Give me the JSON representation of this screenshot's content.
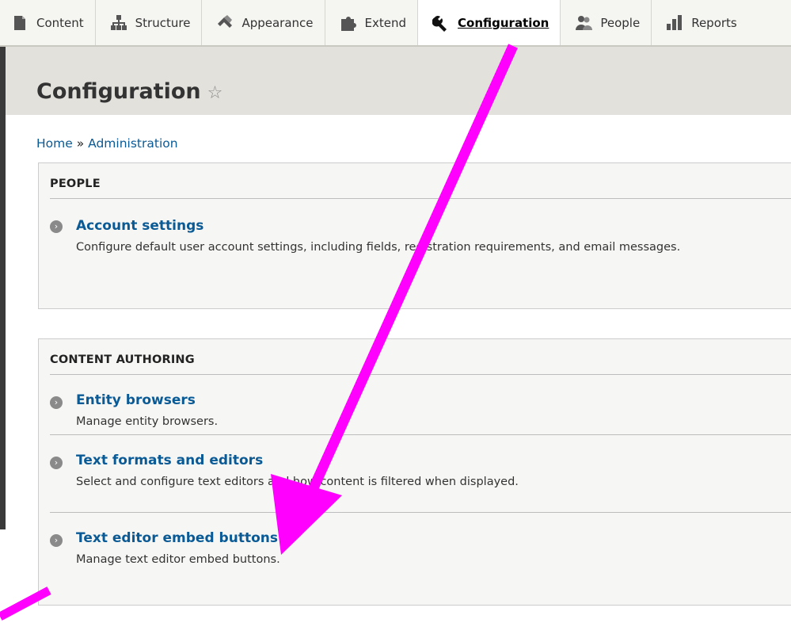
{
  "toolbar": {
    "items": [
      {
        "label": "Content",
        "icon": "document-icon"
      },
      {
        "label": "Structure",
        "icon": "sitemap-icon"
      },
      {
        "label": "Appearance",
        "icon": "paintbrush-icon"
      },
      {
        "label": "Extend",
        "icon": "puzzle-icon"
      },
      {
        "label": "Configuration",
        "icon": "wrench-icon",
        "active": true
      },
      {
        "label": "People",
        "icon": "people-icon"
      },
      {
        "label": "Reports",
        "icon": "bar-chart-icon"
      }
    ]
  },
  "page": {
    "title": "Configuration",
    "star": "☆"
  },
  "breadcrumb": {
    "home": "Home",
    "separator": "»",
    "admin": "Administration"
  },
  "panels": {
    "people": {
      "title": "PEOPLE",
      "entries": [
        {
          "title": "Account settings",
          "desc": "Configure default user account settings, including fields, registration requirements, and email messages."
        }
      ]
    },
    "content_authoring": {
      "title": "CONTENT AUTHORING",
      "entries": [
        {
          "title": "Entity browsers",
          "desc": "Manage entity browsers."
        },
        {
          "title": "Text formats and editors",
          "desc": "Select and configure text editors and how content is filtered when displayed."
        },
        {
          "title": "Text editor embed buttons",
          "desc": "Manage text editor embed buttons."
        }
      ]
    }
  },
  "colors": {
    "link": "#0a5a96",
    "arrow": "#ff00ff",
    "header_band": "#e2e1dc"
  }
}
